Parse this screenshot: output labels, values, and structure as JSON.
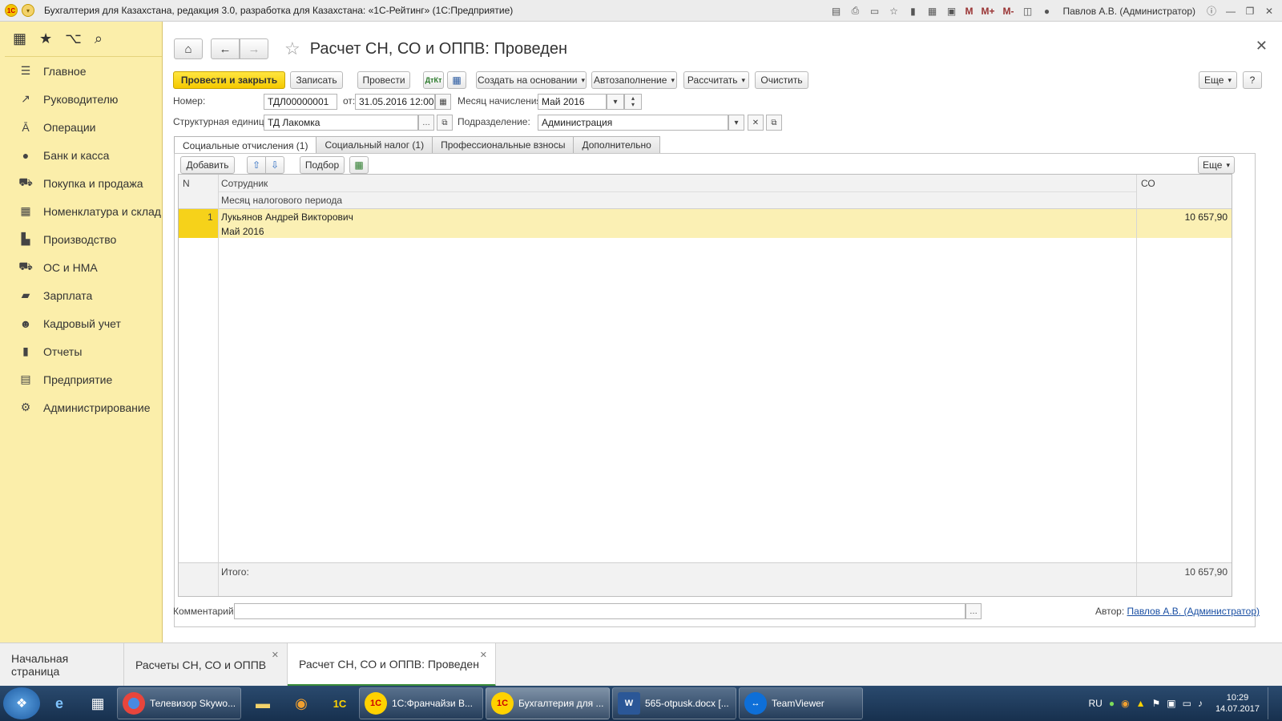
{
  "window": {
    "title": "Бухгалтерия для Казахстана, редакция 3.0, разработка для Казахстана: «1С-Рейтинг» (1С:Предприятие)",
    "user": "Павлов А.В. (Администратор)",
    "m_labels": [
      "M",
      "M+",
      "M-"
    ]
  },
  "sidebar": {
    "items": [
      {
        "label": "Главное",
        "icon": "menu-icon"
      },
      {
        "label": "Руководителю",
        "icon": "trend-icon"
      },
      {
        "label": "Операции",
        "icon": "operations-icon"
      },
      {
        "label": "Банк и касса",
        "icon": "bank-icon"
      },
      {
        "label": "Покупка и продажа",
        "icon": "cart-icon"
      },
      {
        "label": "Номенклатура и склад",
        "icon": "warehouse-icon"
      },
      {
        "label": "Производство",
        "icon": "factory-icon"
      },
      {
        "label": "ОС и НМА",
        "icon": "truck-icon"
      },
      {
        "label": "Зарплата",
        "icon": "salary-icon"
      },
      {
        "label": "Кадровый учет",
        "icon": "people-icon"
      },
      {
        "label": "Отчеты",
        "icon": "chart-icon"
      },
      {
        "label": "Предприятие",
        "icon": "enterprise-icon"
      },
      {
        "label": "Администрирование",
        "icon": "gear-icon"
      }
    ]
  },
  "document": {
    "title": "Расчет СН, СО и ОППВ: Проведен",
    "toolbar": {
      "post_close": "Провести и закрыть",
      "save": "Записать",
      "post": "Провести",
      "create_based": "Создать на основании",
      "autofill": "Автозаполнение",
      "calculate": "Рассчитать",
      "clear": "Очистить",
      "more": "Еще",
      "help": "?"
    },
    "fields": {
      "number_label": "Номер:",
      "number_value": "ТДЛ00000001",
      "date_label": "от:",
      "date_value": "31.05.2016 12:00:0",
      "month_label": "Месяц начисления:",
      "month_value": "Май 2016",
      "unit_label": "Структурная единица:",
      "unit_value": "ТД Лакомка",
      "dept_label": "Подразделение:",
      "dept_value": "Администрация"
    },
    "tabs": [
      "Социальные отчисления (1)",
      "Социальный налог (1)",
      "Профессиональные взносы",
      "Дополнительно"
    ],
    "table_toolbar": {
      "add": "Добавить",
      "select": "Подбор",
      "more": "Еще"
    },
    "table": {
      "headers": {
        "n": "N",
        "employee": "Сотрудник",
        "month": "Месяц налогового периода",
        "so": "СО"
      },
      "rows": [
        {
          "n": "1",
          "employee": "Лукьянов Андрей Викторович",
          "month": "Май 2016",
          "so": "10 657,90"
        }
      ],
      "total_label": "Итого:",
      "total_value": "10 657,90"
    },
    "comment_label": "Комментарий:",
    "author_label": "Автор:",
    "author_value": "Павлов А.В. (Администратор)"
  },
  "bottom_tabs": [
    "Начальная страница",
    "Расчеты СН, СО и ОППВ",
    "Расчет СН, СО и ОППВ: Проведен"
  ],
  "taskbar": {
    "apps": [
      "Телевизор Skywo...",
      "1С:Франчайзи В...",
      "Бухгалтерия для ...",
      "565-otpusk.docx [...",
      "TeamViewer"
    ],
    "lang": "RU",
    "time": "10:29",
    "date": "14.07.2017"
  }
}
